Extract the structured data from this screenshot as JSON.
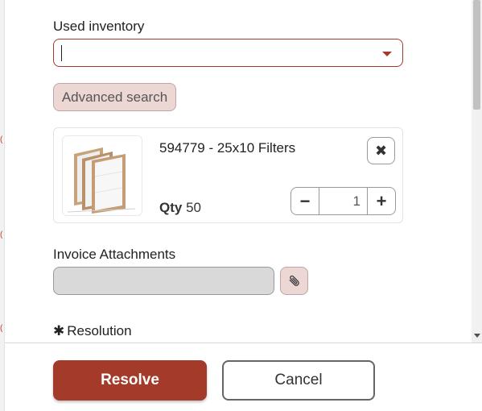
{
  "form": {
    "used_inventory_label": "Used inventory",
    "used_inventory_value": "",
    "advanced_search_label": "Advanced search",
    "item": {
      "title": "594779 - 25x10 Filters",
      "qty_label": "Qty",
      "qty_value": "50",
      "quantity": "1",
      "minus_symbol": "−",
      "plus_symbol": "+",
      "remove_symbol": "✖",
      "image_icon": "air-filter-image"
    },
    "invoice_attachments_label": "Invoice Attachments",
    "attach_icon": "paperclip-icon",
    "resolution_required_mark": "✱",
    "resolution_label": "Resolution"
  },
  "footer": {
    "resolve_label": "Resolve",
    "cancel_label": "Cancel"
  },
  "colors": {
    "accent": "#a33a2a",
    "accent_light": "#ecd7d5",
    "disabled_field": "#d9d9d9"
  }
}
